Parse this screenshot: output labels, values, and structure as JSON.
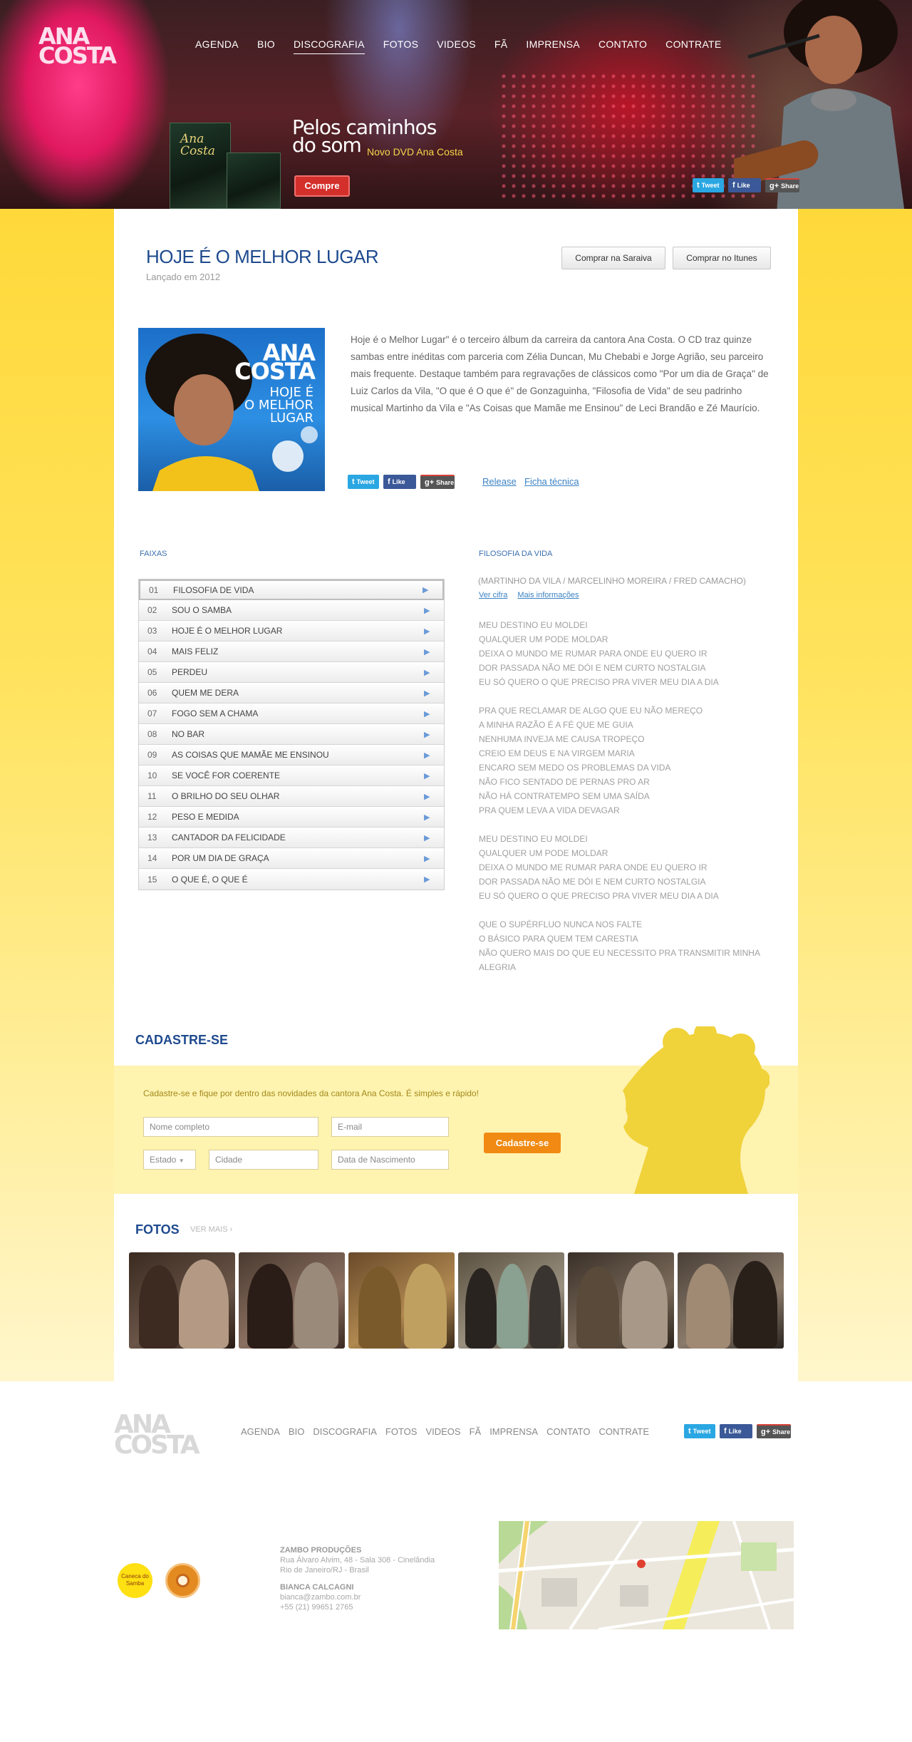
{
  "site": {
    "logo_line1": "ANA",
    "logo_line2": "COSTA"
  },
  "nav": {
    "items": [
      "AGENDA",
      "BIO",
      "DISCOGRAFIA",
      "FOTOS",
      "VIDEOS",
      "FÃ",
      "IMPRENSA",
      "CONTATO",
      "CONTRATE"
    ],
    "active": "DISCOGRAFIA"
  },
  "hero": {
    "promo_line1": "Pelos caminhos",
    "promo_line2": "do som",
    "promo_sub": "Novo DVD Ana Costa",
    "buy_button": "Compre",
    "dvd_title": "Ana Costa"
  },
  "share": {
    "tweet": "Tweet",
    "like": "Like",
    "share": "Share"
  },
  "album": {
    "title": "HOJE É O MELHOR LUGAR",
    "released": "Lançado em 2012",
    "buy_saraiva": "Comprar na Saraiva",
    "buy_itunes": "Comprar no Itunes",
    "cover_line1": "ANA",
    "cover_line2": "COSTA",
    "cover_line3": "HOJE É",
    "cover_line4": "O MELHOR",
    "cover_line5": "LUGAR",
    "description": "Hoje é o Melhor Lugar\" é o terceiro álbum da carreira da cantora Ana Costa. O CD traz quinze sambas entre inéditas com parceria com Zélia Duncan, Mu Chebabi e Jorge Agrião, seu parceiro mais frequente. Destaque também para regravações de clássicos como \"Por um dia de Graça\" de Luiz Carlos da Vila, \"O que é O que é\" de Gonzaguinha, \"Filosofia de Vida\" de seu padrinho musical Martinho da Vila e \"As Coisas que Mamãe me Ensinou\" de Leci Brandão e Zé Maurício.",
    "link_release": "Release",
    "link_ficha": "Ficha técnica"
  },
  "tracks": {
    "label": "FAIXAS",
    "items": [
      {
        "num": "01",
        "name": "FILOSOFIA DE VIDA"
      },
      {
        "num": "02",
        "name": "SOU O SAMBA"
      },
      {
        "num": "03",
        "name": "HOJE É O MELHOR LUGAR"
      },
      {
        "num": "04",
        "name": "MAIS FELIZ"
      },
      {
        "num": "05",
        "name": "PERDEU"
      },
      {
        "num": "06",
        "name": "QUEM ME DERA"
      },
      {
        "num": "07",
        "name": "FOGO SEM A CHAMA"
      },
      {
        "num": "08",
        "name": "NO BAR"
      },
      {
        "num": "09",
        "name": "AS COISAS QUE MAMÃE ME ENSINOU"
      },
      {
        "num": "10",
        "name": "SE VOCÊ FOR COERENTE"
      },
      {
        "num": "11",
        "name": "O BRILHO DO SEU OLHAR"
      },
      {
        "num": "12",
        "name": "PESO E MEDIDA"
      },
      {
        "num": "13",
        "name": "CANTADOR DA FELICIDADE"
      },
      {
        "num": "14",
        "name": "POR UM DIA DE GRAÇA"
      },
      {
        "num": "15",
        "name": "O QUE É, O QUE É"
      }
    ]
  },
  "lyrics": {
    "title": "FILOSOFIA DA VIDA",
    "credit": "(MARTINHO DA VILA / MARCELINHO MOREIRA / FRED CAMACHO)",
    "link_cifra": "Ver cifra",
    "link_info": "Mais informações",
    "stanzas": [
      [
        "MEU DESTINO EU MOLDEI",
        "QUALQUER UM PODE MOLDAR",
        "DEIXA O MUNDO ME RUMAR PARA ONDE EU QUERO IR",
        "DOR PASSADA NÃO ME DÓI E NEM CURTO NOSTALGIA",
        "EU SÓ QUERO O QUE PRECISO PRA VIVER MEU DIA A DIA"
      ],
      [
        "PRA QUE RECLAMAR DE ALGO QUE EU NÃO MEREÇO",
        "A MINHA RAZÃO É A FÉ QUE ME GUIA",
        "NENHUMA INVEJA ME CAUSA TROPEÇO",
        "CREIO EM DEUS E NA VIRGEM MARIA",
        "ENCARO SEM MEDO OS PROBLEMAS DA VIDA",
        "NÃO FICO SENTADO DE PERNAS PRO AR",
        "NÃO HÁ CONTRATEMPO SEM UMA SAÍDA",
        "PRA QUEM LEVA A VIDA DEVAGAR"
      ],
      [
        "MEU DESTINO EU MOLDEI",
        "QUALQUER UM PODE MOLDAR",
        "DEIXA O MUNDO ME RUMAR PARA ONDE EU QUERO IR",
        "DOR PASSADA NÃO ME DÓI E NEM CURTO NOSTALGIA",
        "EU SÓ QUERO O QUE PRECISO PRA VIVER MEU DIA A DIA"
      ],
      [
        "QUE O SUPÉRFLUO NUNCA NOS FALTE",
        "O BÁSICO PARA QUEM TEM CARESTIA",
        "NÃO QUERO MAIS DO QUE EU NECESSITO PRA TRANSMITIR MINHA ALEGRIA"
      ]
    ]
  },
  "signup": {
    "title": "CADASTRE-SE",
    "text": "Cadastre-se e fique por dentro das novidades da cantora Ana Costa. É simples e rápido!",
    "name_placeholder": "Nome completo",
    "email_placeholder": "E-mail",
    "state_placeholder": "Estado",
    "city_placeholder": "Cidade",
    "birth_placeholder": "Data de Nascimento",
    "submit": "Cadastre-se"
  },
  "photos": {
    "title": "FOTOS",
    "see_more": "VER MAIS"
  },
  "footer": {
    "company": "ZAMBO PRODUÇÕES",
    "address1": "Rua Álvaro Alvim, 48 - Sala 308 - Cinelândia",
    "address2": "Rio de Janeiro/RJ - Brasil",
    "contact_name": "BIANCA CALCAGNI",
    "contact_email": "bianca@zambo.com.br",
    "contact_phone": "+55 (21) 99651 2765",
    "badge1_text": "Caneca do Samba"
  },
  "colors": {
    "accent_blue": "#1e4a8e",
    "link_blue": "#3a82c4",
    "orange": "#f08a13",
    "red": "#d3302b",
    "yellow": "#ffd93a"
  }
}
